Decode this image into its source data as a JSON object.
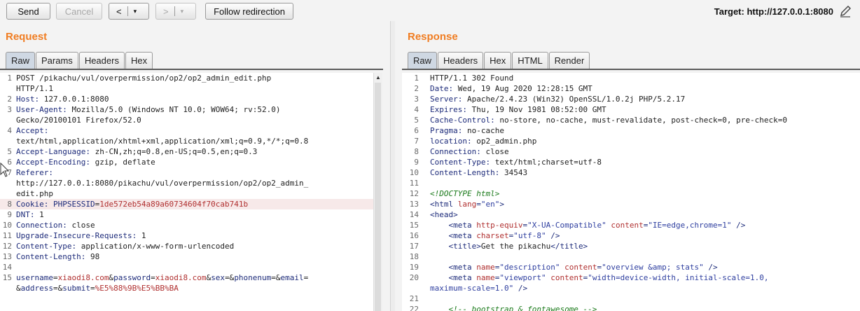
{
  "toolbar": {
    "send_label": "Send",
    "cancel_label": "Cancel",
    "back_glyph": "<",
    "forward_glyph": ">",
    "dropdown_glyph": "▾",
    "follow_label": "Follow redirection",
    "target_text": "Target: http://127.0.0.1:8080"
  },
  "request": {
    "title": "Request",
    "tabs": [
      "Raw",
      "Params",
      "Headers",
      "Hex"
    ],
    "active_tab": "Raw"
  },
  "response": {
    "title": "Response",
    "tabs": [
      "Raw",
      "Headers",
      "Hex",
      "HTML",
      "Render"
    ],
    "active_tab": "Raw"
  },
  "request_lines": [
    {
      "n": "1",
      "segs": [
        [
          "v",
          "POST /pikachu/vul/overpermission/op2/op2_admin_edit.php"
        ]
      ]
    },
    {
      "n": "",
      "segs": [
        [
          "v",
          "HTTP/1.1"
        ]
      ]
    },
    {
      "n": "2",
      "segs": [
        [
          "k",
          "Host: "
        ],
        [
          "v",
          "127.0.0.1:8080"
        ]
      ]
    },
    {
      "n": "3",
      "segs": [
        [
          "k",
          "User-Agent: "
        ],
        [
          "v",
          "Mozilla/5.0 (Windows NT 10.0; WOW64; rv:52.0)"
        ]
      ]
    },
    {
      "n": "",
      "segs": [
        [
          "v",
          "Gecko/20100101 Firefox/52.0"
        ]
      ]
    },
    {
      "n": "4",
      "segs": [
        [
          "k",
          "Accept:"
        ]
      ]
    },
    {
      "n": "",
      "segs": [
        [
          "v",
          "text/html,application/xhtml+xml,application/xml;q=0.9,*/*;q=0.8"
        ]
      ]
    },
    {
      "n": "5",
      "segs": [
        [
          "k",
          "Accept-Language: "
        ],
        [
          "v",
          "zh-CN,zh;q=0.8,en-US;q=0.5,en;q=0.3"
        ]
      ]
    },
    {
      "n": "6",
      "segs": [
        [
          "k",
          "Accept-Encoding: "
        ],
        [
          "v",
          "gzip, deflate"
        ]
      ]
    },
    {
      "n": "7",
      "segs": [
        [
          "k",
          "Referer:"
        ]
      ]
    },
    {
      "n": "",
      "segs": [
        [
          "v",
          "http://127.0.0.1:8080/pikachu/vul/overpermission/op2/op2_admin_"
        ]
      ]
    },
    {
      "n": "",
      "segs": [
        [
          "v",
          "edit.php"
        ]
      ]
    },
    {
      "n": "8",
      "hl": true,
      "segs": [
        [
          "k",
          "Cookie: "
        ],
        [
          "k",
          "PHPSESSID"
        ],
        [
          "v",
          "="
        ],
        [
          "r",
          "1de572eb54a89a60734604f70cab741b"
        ]
      ]
    },
    {
      "n": "9",
      "segs": [
        [
          "k",
          "DNT: "
        ],
        [
          "v",
          "1"
        ]
      ]
    },
    {
      "n": "10",
      "segs": [
        [
          "k",
          "Connection: "
        ],
        [
          "v",
          "close"
        ]
      ]
    },
    {
      "n": "11",
      "segs": [
        [
          "k",
          "Upgrade-Insecure-Requests: "
        ],
        [
          "v",
          "1"
        ]
      ]
    },
    {
      "n": "12",
      "segs": [
        [
          "k",
          "Content-Type: "
        ],
        [
          "v",
          "application/x-www-form-urlencoded"
        ]
      ]
    },
    {
      "n": "13",
      "segs": [
        [
          "k",
          "Content-Length: "
        ],
        [
          "v",
          "98"
        ]
      ]
    },
    {
      "n": "14",
      "segs": []
    },
    {
      "n": "15",
      "segs": [
        [
          "k",
          "username"
        ],
        [
          "v",
          "="
        ],
        [
          "r",
          "xiaodi8.com"
        ],
        [
          "v",
          "&"
        ],
        [
          "k",
          "password"
        ],
        [
          "v",
          "="
        ],
        [
          "r",
          "xiaodi8.com"
        ],
        [
          "v",
          "&"
        ],
        [
          "k",
          "sex"
        ],
        [
          "v",
          "=&"
        ],
        [
          "k",
          "phonenum"
        ],
        [
          "v",
          "=&"
        ],
        [
          "k",
          "email"
        ],
        [
          "v",
          "="
        ]
      ]
    },
    {
      "n": "",
      "segs": [
        [
          "v",
          "&"
        ],
        [
          "k",
          "address"
        ],
        [
          "v",
          "=&"
        ],
        [
          "k",
          "submit"
        ],
        [
          "v",
          "="
        ],
        [
          "r",
          "%E5%88%9B%E5%BB%BA"
        ]
      ]
    }
  ],
  "response_lines": [
    {
      "n": "1",
      "fold": true,
      "segs": [
        [
          "v",
          "HTTP/1.1 302 Found"
        ]
      ]
    },
    {
      "n": "2",
      "segs": [
        [
          "k",
          "Date: "
        ],
        [
          "v",
          "Wed, 19 Aug 2020 12:28:15 GMT"
        ]
      ]
    },
    {
      "n": "3",
      "segs": [
        [
          "k",
          "Server: "
        ],
        [
          "v",
          "Apache/2.4.23 (Win32) OpenSSL/1.0.2j PHP/5.2.17"
        ]
      ]
    },
    {
      "n": "4",
      "segs": [
        [
          "k",
          "Expires: "
        ],
        [
          "v",
          "Thu, 19 Nov 1981 08:52:00 GMT"
        ]
      ]
    },
    {
      "n": "5",
      "segs": [
        [
          "k",
          "Cache-Control: "
        ],
        [
          "v",
          "no-store, no-cache, must-revalidate, post-check=0, pre-check=0"
        ]
      ]
    },
    {
      "n": "6",
      "segs": [
        [
          "k",
          "Pragma: "
        ],
        [
          "v",
          "no-cache"
        ]
      ]
    },
    {
      "n": "7",
      "segs": [
        [
          "k",
          "location: "
        ],
        [
          "v",
          "op2_admin.php"
        ]
      ]
    },
    {
      "n": "8",
      "segs": [
        [
          "k",
          "Connection: "
        ],
        [
          "v",
          "close"
        ]
      ]
    },
    {
      "n": "9",
      "segs": [
        [
          "k",
          "Content-Type: "
        ],
        [
          "v",
          "text/html;charset=utf-8"
        ]
      ]
    },
    {
      "n": "10",
      "segs": [
        [
          "k",
          "Content-Length: "
        ],
        [
          "v",
          "34543"
        ]
      ]
    },
    {
      "n": "11",
      "segs": []
    },
    {
      "n": "12",
      "segs": [
        [
          "cm",
          "<!DOCTYPE html>"
        ]
      ]
    },
    {
      "n": "13",
      "segs": [
        [
          "tag",
          "<html "
        ],
        [
          "attr",
          "lang"
        ],
        [
          "tag",
          "="
        ],
        [
          "str",
          "\"en\""
        ],
        [
          "tag",
          ">"
        ]
      ]
    },
    {
      "n": "14",
      "segs": [
        [
          "tag",
          "<head>"
        ]
      ]
    },
    {
      "n": "15",
      "segs": [
        [
          "v",
          "    "
        ],
        [
          "tag",
          "<meta "
        ],
        [
          "attr",
          "http-equiv"
        ],
        [
          "tag",
          "="
        ],
        [
          "str",
          "\"X-UA-Compatible\""
        ],
        [
          "v",
          " "
        ],
        [
          "attr",
          "content"
        ],
        [
          "tag",
          "="
        ],
        [
          "str",
          "\"IE=edge,chrome=1\""
        ],
        [
          "tag",
          " />"
        ]
      ]
    },
    {
      "n": "16",
      "segs": [
        [
          "v",
          "    "
        ],
        [
          "tag",
          "<meta "
        ],
        [
          "attr",
          "charset"
        ],
        [
          "tag",
          "="
        ],
        [
          "str",
          "\"utf-8\""
        ],
        [
          "tag",
          " />"
        ]
      ]
    },
    {
      "n": "17",
      "segs": [
        [
          "v",
          "    "
        ],
        [
          "tag",
          "<title>"
        ],
        [
          "v",
          "Get the pikachu"
        ],
        [
          "tag",
          "</title>"
        ]
      ]
    },
    {
      "n": "18",
      "segs": []
    },
    {
      "n": "19",
      "segs": [
        [
          "v",
          "    "
        ],
        [
          "tag",
          "<meta "
        ],
        [
          "attr",
          "name"
        ],
        [
          "tag",
          "="
        ],
        [
          "str",
          "\"description\""
        ],
        [
          "v",
          " "
        ],
        [
          "attr",
          "content"
        ],
        [
          "tag",
          "="
        ],
        [
          "str",
          "\"overview &amp; stats\""
        ],
        [
          "tag",
          " />"
        ]
      ]
    },
    {
      "n": "20",
      "segs": [
        [
          "v",
          "    "
        ],
        [
          "tag",
          "<meta "
        ],
        [
          "attr",
          "name"
        ],
        [
          "tag",
          "="
        ],
        [
          "str",
          "\"viewport\""
        ],
        [
          "v",
          " "
        ],
        [
          "attr",
          "content"
        ],
        [
          "tag",
          "="
        ],
        [
          "str",
          "\"width=device-width, initial-scale=1.0,"
        ]
      ]
    },
    {
      "n": "",
      "segs": [
        [
          "str",
          "maximum-scale=1.0\""
        ],
        [
          "tag",
          " />"
        ]
      ]
    },
    {
      "n": "21",
      "segs": []
    },
    {
      "n": "22",
      "segs": [
        [
          "v",
          "    "
        ],
        [
          "cm",
          "<!-- bootstrap & fontawesome -->"
        ]
      ]
    }
  ]
}
